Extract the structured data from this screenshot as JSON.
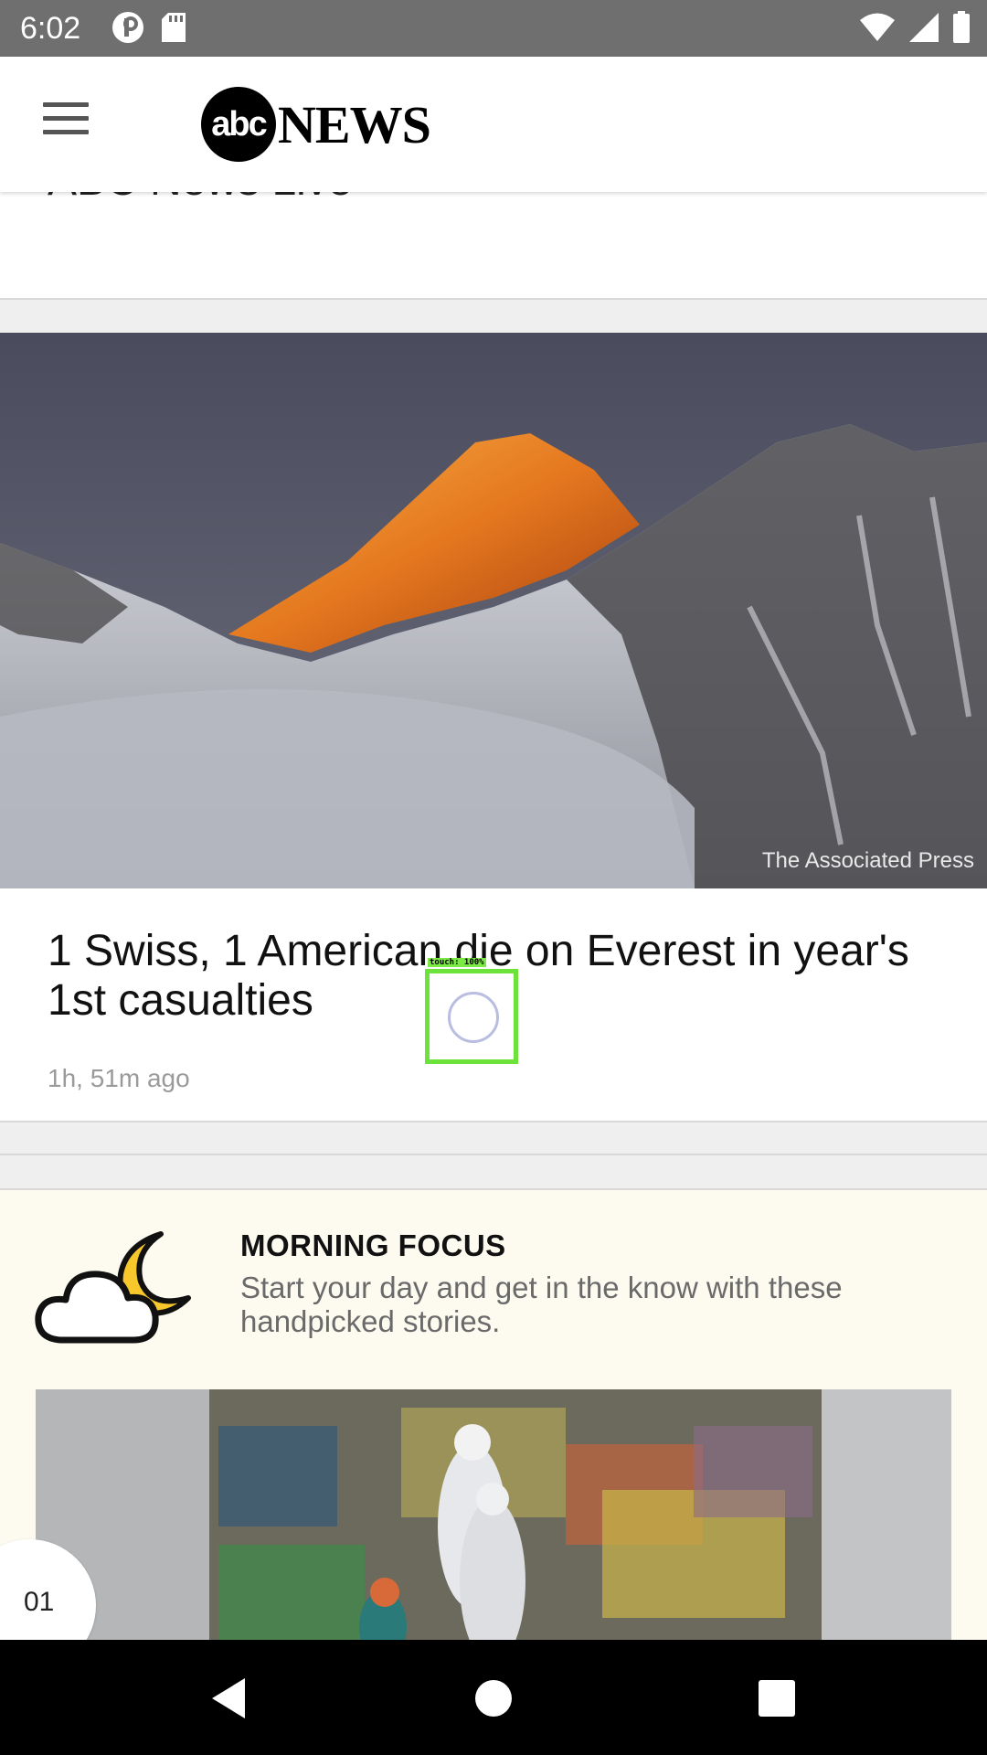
{
  "status_bar": {
    "time": "6:02",
    "left_icons": [
      "circle-p-icon",
      "sd-card-icon"
    ],
    "right_icons": [
      "wifi-icon",
      "signal-icon",
      "battery-icon"
    ]
  },
  "header": {
    "logo_circle_text": "abc",
    "logo_word": "NEWS",
    "menu_icon": "hamburger-menu-icon"
  },
  "prev_card": {
    "title_partial": "ABC News Live"
  },
  "story": {
    "image_credit": "The Associated Press",
    "title": "1 Swiss, 1 American die on Everest in year's 1st casualties",
    "time_ago": "1h, 51m ago"
  },
  "touch_overlay": {
    "label": "touch: 100%"
  },
  "morning_focus": {
    "heading": "MORNING FOCUS",
    "subtitle": "Start your day and get in the know with these handpicked stories.",
    "icon": "cloud-moon-icon",
    "page_number": "01"
  },
  "nav_bar": {
    "back_icon": "back-triangle-icon",
    "home_icon": "home-circle-icon",
    "recents_icon": "recents-square-icon"
  }
}
